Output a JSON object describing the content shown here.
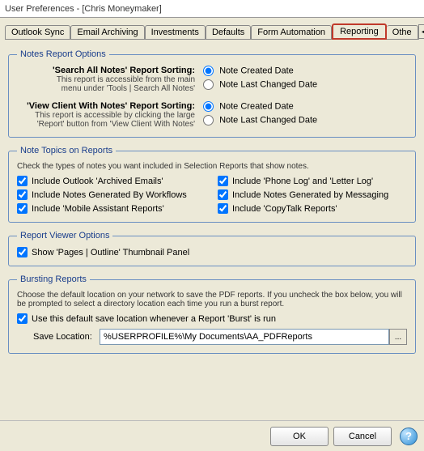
{
  "window": {
    "title": "User Preferences -   [Chris Moneymaker]"
  },
  "tabs": {
    "t0": "Outlook Sync",
    "t1": "Email Archiving",
    "t2": "Investments",
    "t3": "Defaults",
    "t4": "Form Automation",
    "t5": "Reporting",
    "t6": "Othe"
  },
  "notesReport": {
    "legend": "Notes Report Options",
    "searchAll": {
      "title": "'Search All Notes' Report Sorting:",
      "sub1": "This report is accessible from the main",
      "sub2": "menu under  'Tools | Search All Notes'"
    },
    "viewClient": {
      "title": "'View Client With Notes' Report Sorting:",
      "sub1": "This report is accessible by clicking the large",
      "sub2": "'Report' button from 'View Client With Notes'"
    },
    "optCreated": "Note Created Date",
    "optChanged": "Note Last Changed Date"
  },
  "topics": {
    "legend": "Note Topics on Reports",
    "desc": "Check the types of notes you want included in Selection Reports that show notes.",
    "c1": "Include Outlook 'Archived Emails'",
    "c2": "Include 'Phone Log' and 'Letter Log'",
    "c3": "Include Notes Generated By Workflows",
    "c4": "Include Notes Generated by Messaging",
    "c5": "Include 'Mobile Assistant Reports'",
    "c6": "Include 'CopyTalk Reports'"
  },
  "viewer": {
    "legend": "Report Viewer Options",
    "c1": "Show 'Pages | Outline' Thumbnail Panel"
  },
  "bursting": {
    "legend": "Bursting Reports",
    "desc": "Choose the default location on your network to save the PDF reports. If you uncheck the box below, you will be prompted to select a directory location each time you run a burst report.",
    "c1": "Use this default save location whenever a Report 'Burst' is run",
    "saveLabel": "Save Location:",
    "saveValue": "%USERPROFILE%\\My Documents\\AA_PDFReports",
    "browse": "..."
  },
  "buttons": {
    "ok": "OK",
    "cancel": "Cancel",
    "help": "?"
  }
}
